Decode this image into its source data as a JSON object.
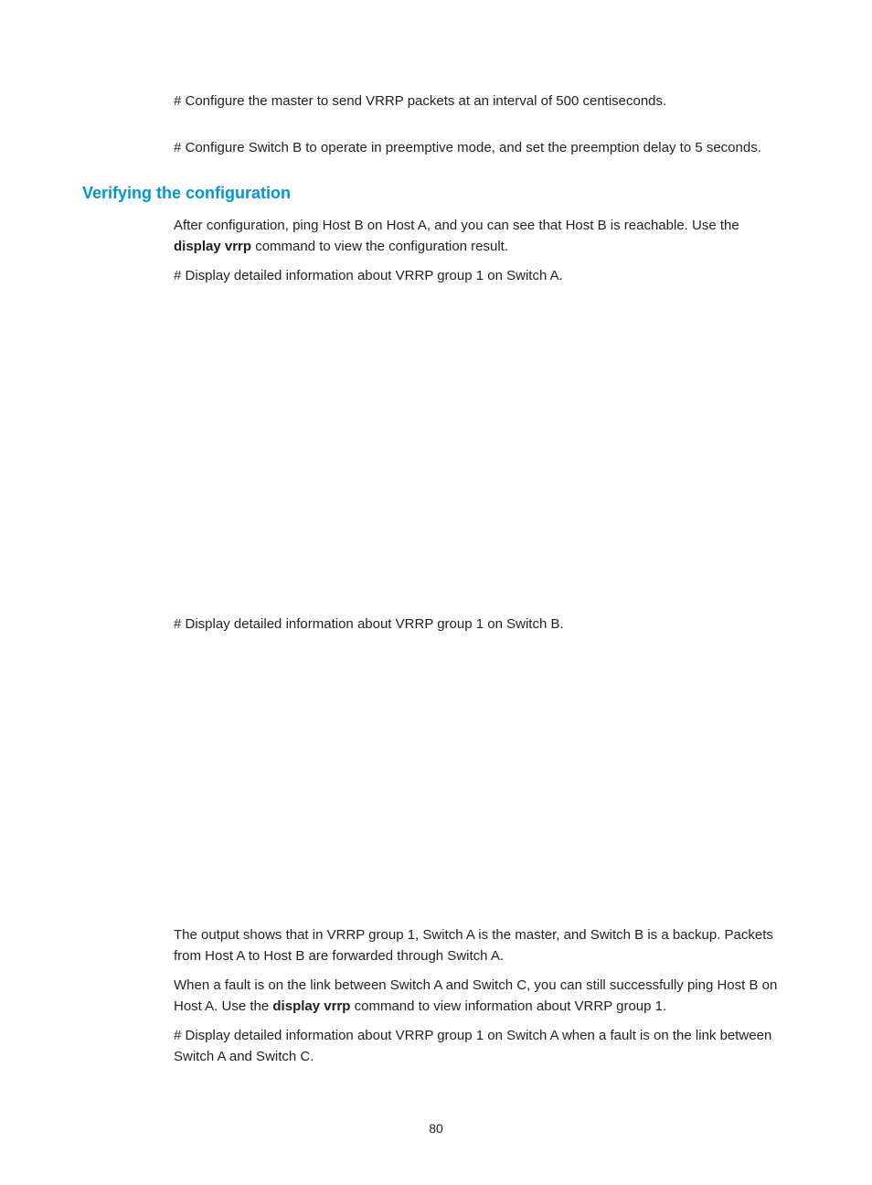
{
  "para1": "# Configure the master to send VRRP packets at an interval of 500 centiseconds.",
  "para2": "# Configure Switch B to operate in preemptive mode, and set the preemption delay to 5 seconds.",
  "section_heading": "Verifying the configuration",
  "para3_part1": "After configuration, ping Host B on Host A, and you can see that Host B is reachable. Use the ",
  "para3_bold": "display vrrp",
  "para3_part2": " command to view the configuration result.",
  "para4": "# Display detailed information about VRRP group 1 on Switch A.",
  "para5": "# Display detailed information about VRRP group 1 on Switch B.",
  "para6": "The output shows that in VRRP group 1, Switch A is the master, and Switch B is a backup. Packets from Host A to Host B are forwarded through Switch A.",
  "para7_part1": "When a fault is on the link between Switch A and Switch C, you can still successfully ping Host B on Host A. Use the ",
  "para7_bold": "display vrrp",
  "para7_part2": " command to view information about VRRP group 1.",
  "para8": "# Display detailed information about VRRP group 1 on Switch A when a fault is on the link between Switch A and Switch C.",
  "page_number": "80"
}
